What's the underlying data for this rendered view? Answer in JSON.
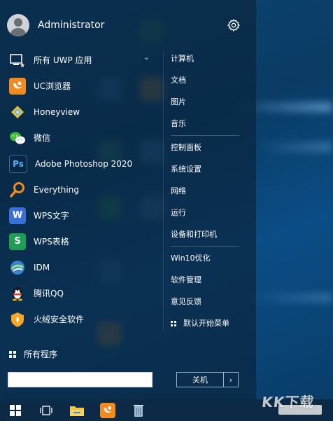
{
  "window_hint": "",
  "user": {
    "name": "Administrator",
    "avatar_icon": "user-avatar-icon"
  },
  "settings_icon": "gear-icon",
  "apps": [
    {
      "label": "所有 UWP 应用",
      "icon": "uwp-apps-icon",
      "has_chevron": true
    },
    {
      "label": "UC浏览器",
      "icon": "uc-browser-icon"
    },
    {
      "label": "Honeyview",
      "icon": "honeyview-icon"
    },
    {
      "label": "微信",
      "icon": "wechat-icon"
    },
    {
      "label": "Adobe Photoshop 2020",
      "icon": "photoshop-icon"
    },
    {
      "label": "Everything",
      "icon": "everything-search-icon"
    },
    {
      "label": "WPS文字",
      "icon": "wps-writer-icon"
    },
    {
      "label": "WPS表格",
      "icon": "wps-spreadsheet-icon"
    },
    {
      "label": "IDM",
      "icon": "idm-icon"
    },
    {
      "label": "腾讯QQ",
      "icon": "qq-icon"
    },
    {
      "label": "火绒安全软件",
      "icon": "huorong-icon"
    }
  ],
  "all_programs": "所有程序",
  "search": {
    "value": "",
    "placeholder": ""
  },
  "right_menu": {
    "group1": [
      "计算机",
      "文档",
      "图片",
      "音乐"
    ],
    "group2": [
      "控制面板",
      "系统设置",
      "网络",
      "运行",
      "设备和打印机"
    ],
    "group3": [
      "Win10优化",
      "软件管理",
      "意见反馈",
      "默认开始菜单"
    ]
  },
  "shutdown": {
    "label": "关机",
    "arrow": "›"
  },
  "taskbar": {
    "items": [
      "windows-start-icon",
      "task-view-icon",
      "file-explorer-icon",
      "uc-browser-icon",
      "recycle-bin-icon"
    ]
  },
  "watermark": {
    "text": "KK下载"
  },
  "colors": {
    "menu_bg": "#0a2640",
    "desktop_bg": "#0b4676",
    "taskbar_bg": "#0c2a45"
  }
}
